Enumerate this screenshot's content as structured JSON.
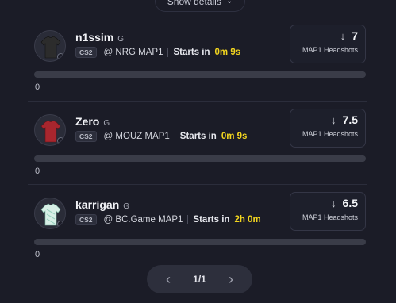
{
  "show_details": {
    "label": "Show details",
    "chevron_icon": "chevron-down-icon"
  },
  "players": [
    {
      "name": "n1ssim",
      "position": "G",
      "game": "CS2",
      "matchup": "@ NRG MAP1",
      "starts_label": "Starts in",
      "countdown": "0m 9s",
      "line_value": "7",
      "line_direction": "down",
      "stat_label": "MAP1 Headshots",
      "progress_count": "0",
      "progress_fraction": 0,
      "jersey_color": "#2c2c2c",
      "jersey_accent": "#1a1a1a"
    },
    {
      "name": "Zero",
      "position": "G",
      "game": "CS2",
      "matchup": "@ MOUZ MAP1",
      "starts_label": "Starts in",
      "countdown": "0m 9s",
      "line_value": "7.5",
      "line_direction": "down",
      "stat_label": "MAP1 Headshots",
      "progress_count": "0",
      "progress_fraction": 0,
      "jersey_color": "#a8262e",
      "jersey_accent": "#7a1a20"
    },
    {
      "name": "karrigan",
      "position": "G",
      "game": "CS2",
      "matchup": "@ BC.Game MAP1",
      "starts_label": "Starts in",
      "countdown": "2h 0m",
      "line_value": "6.5",
      "line_direction": "down",
      "stat_label": "MAP1 Headshots",
      "progress_count": "0",
      "progress_fraction": 0,
      "jersey_color": "#d7efe6",
      "jersey_accent": "#9ad2c0"
    }
  ],
  "pagination": {
    "text": "1/1",
    "prev_icon": "chevron-left-icon",
    "next_icon": "chevron-right-icon"
  },
  "colors": {
    "countdown": "#f2d51f",
    "background": "#1b1c27"
  }
}
